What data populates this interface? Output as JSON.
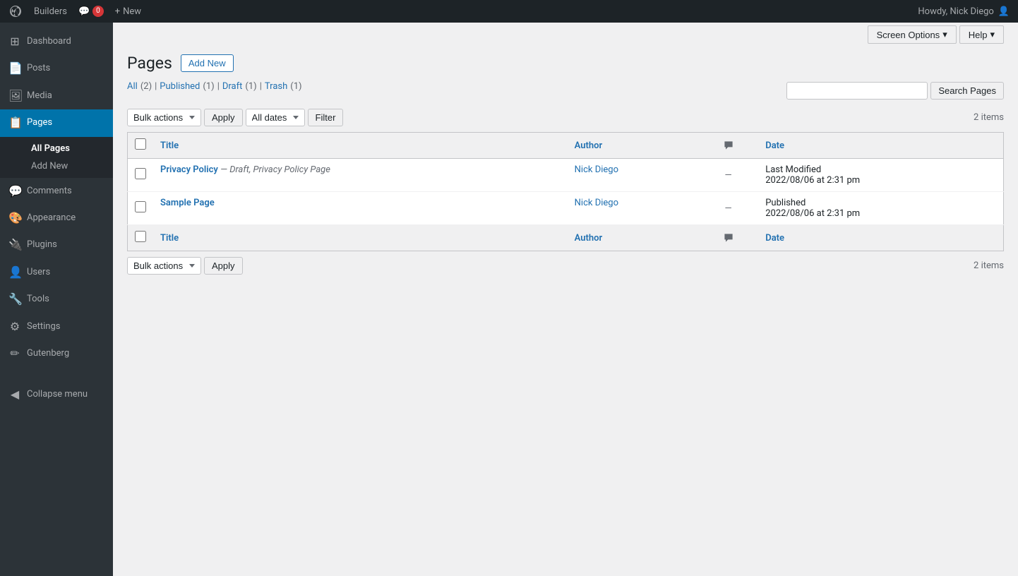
{
  "adminbar": {
    "site_name": "Builders",
    "comment_count": "0",
    "new_label": "New",
    "user_greeting": "Howdy, Nick Diego"
  },
  "top_bar": {
    "screen_options_label": "Screen Options",
    "help_label": "Help"
  },
  "sidebar": {
    "items": [
      {
        "id": "dashboard",
        "label": "Dashboard",
        "icon": "⊞"
      },
      {
        "id": "posts",
        "label": "Posts",
        "icon": "📄"
      },
      {
        "id": "media",
        "label": "Media",
        "icon": "🖼"
      },
      {
        "id": "pages",
        "label": "Pages",
        "icon": "📋",
        "active": true
      },
      {
        "id": "comments",
        "label": "Comments",
        "icon": "💬"
      },
      {
        "id": "appearance",
        "label": "Appearance",
        "icon": "🎨"
      },
      {
        "id": "plugins",
        "label": "Plugins",
        "icon": "🔌"
      },
      {
        "id": "users",
        "label": "Users",
        "icon": "👤"
      },
      {
        "id": "tools",
        "label": "Tools",
        "icon": "🔧"
      },
      {
        "id": "settings",
        "label": "Settings",
        "icon": "⚙"
      },
      {
        "id": "gutenberg",
        "label": "Gutenberg",
        "icon": "✏"
      }
    ],
    "pages_sub": [
      {
        "id": "all-pages",
        "label": "All Pages",
        "active": true
      },
      {
        "id": "add-new",
        "label": "Add New"
      }
    ],
    "collapse_label": "Collapse menu"
  },
  "page": {
    "title": "Pages",
    "add_new_label": "Add New"
  },
  "filter_links": {
    "all_label": "All",
    "all_count": "(2)",
    "published_label": "Published",
    "published_count": "(1)",
    "draft_label": "Draft",
    "draft_count": "(1)",
    "trash_label": "Trash",
    "trash_count": "(1)"
  },
  "search": {
    "placeholder": "",
    "button_label": "Search Pages"
  },
  "toolbar": {
    "bulk_actions_label": "Bulk actions",
    "apply_label": "Apply",
    "all_dates_label": "All dates",
    "filter_label": "Filter",
    "items_count": "2 items"
  },
  "table": {
    "headers": {
      "title": "Title",
      "author": "Author",
      "date": "Date"
    },
    "rows": [
      {
        "id": 1,
        "title": "Privacy Policy",
        "state": "Draft, Privacy Policy Page",
        "author": "Nick Diego",
        "date_label": "Last Modified",
        "date_value": "2022/08/06 at 2:31 pm"
      },
      {
        "id": 2,
        "title": "Sample Page",
        "state": "",
        "author": "Nick Diego",
        "date_label": "Published",
        "date_value": "2022/08/06 at 2:31 pm"
      }
    ]
  },
  "bottom_toolbar": {
    "bulk_actions_label": "Bulk actions",
    "apply_label": "Apply",
    "items_count": "2 items"
  }
}
